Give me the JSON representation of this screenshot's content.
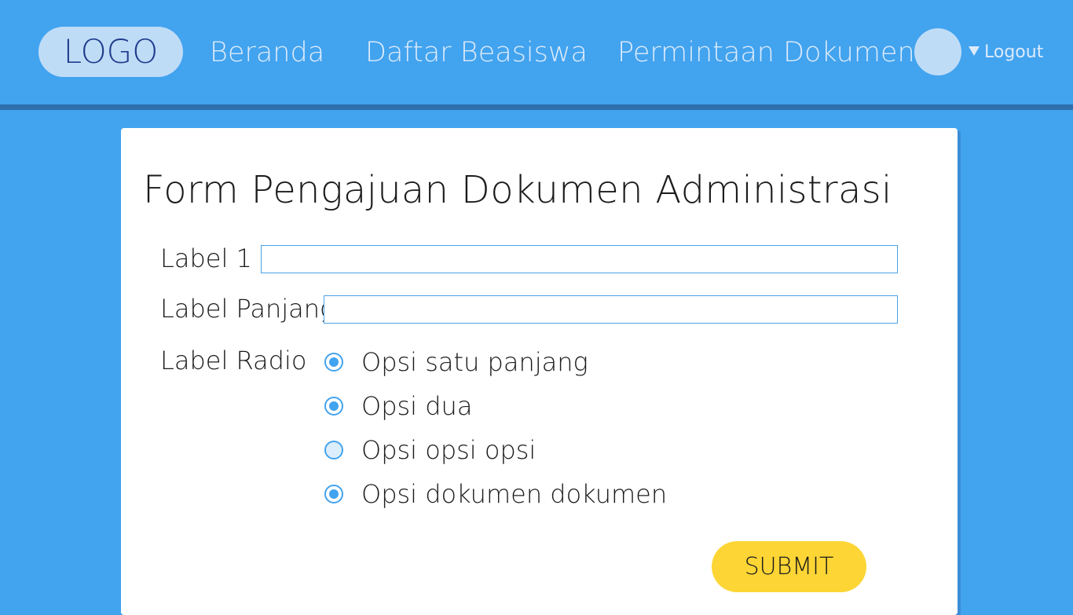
{
  "header": {
    "logo": "LOGO",
    "nav": [
      "Beranda",
      "Daftar Beasiswa",
      "Permintaan Dokumen"
    ],
    "logout_label": "Logout",
    "bg_color": "#42a3ef"
  },
  "form": {
    "title": "Form Pengajuan Dokumen Administrasi",
    "field1": {
      "label": "Label 1",
      "value": "",
      "placeholder": ""
    },
    "field2": {
      "label": "Label Panjang",
      "value": "",
      "placeholder": ""
    },
    "radio": {
      "label": "Label Radio",
      "options": [
        {
          "label": "Opsi satu panjang",
          "checked": true
        },
        {
          "label": "Opsi dua",
          "checked": true
        },
        {
          "label": "Opsi opsi opsi",
          "checked": false
        },
        {
          "label": "Opsi dokumen dokumen",
          "checked": true
        }
      ]
    },
    "submit_label": "SUBMIT",
    "submit_color": "#fdd535"
  }
}
